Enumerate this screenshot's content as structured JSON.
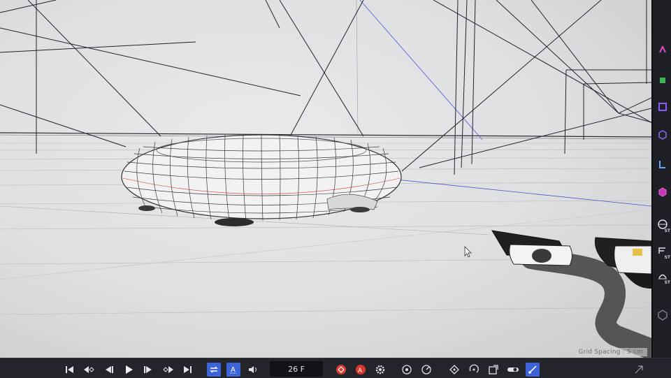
{
  "viewport": {
    "grid_spacing_label": "Grid Spacing : 5 cm"
  },
  "timeline": {
    "current_frame": "26 F",
    "buttons": [
      "go-to-start",
      "previous-keyframe",
      "previous-frame",
      "play",
      "next-frame",
      "next-keyframe",
      "go-to-end",
      "loop",
      "autokey",
      "sound",
      "record",
      "autokey-red",
      "keyframe-settings",
      "motion-path",
      "keyframe-tool",
      "scale-tool",
      "rotate-tool",
      "pla-tool",
      "brush-tool"
    ]
  },
  "right_toolbar": {
    "badges": [
      "ST",
      "ST",
      "ST"
    ]
  },
  "colors": {
    "accent": "#3d63d8",
    "record_red": "#d9392f",
    "toolbar_bg": "#1e2026",
    "viewport_bg": "#e2e3e4"
  }
}
